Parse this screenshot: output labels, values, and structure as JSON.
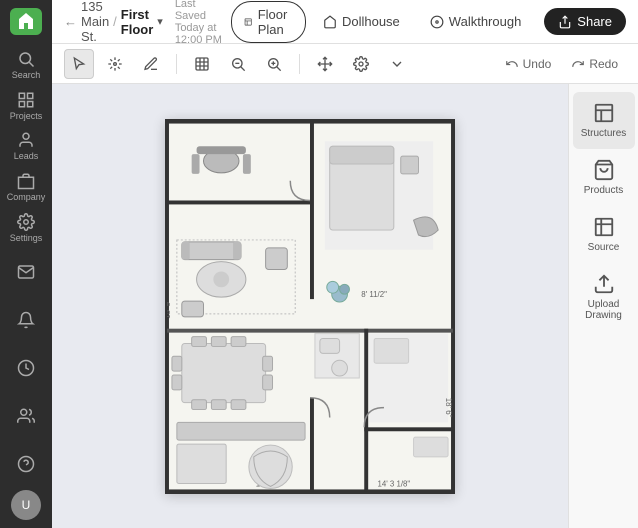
{
  "sidebar": {
    "logo_letter": "h",
    "items": [
      {
        "id": "search",
        "label": "Search",
        "icon": "search"
      },
      {
        "id": "projects",
        "label": "Projects",
        "icon": "grid"
      },
      {
        "id": "leads",
        "label": "Leads",
        "icon": "person"
      },
      {
        "id": "company",
        "label": "Company",
        "icon": "building"
      },
      {
        "id": "settings",
        "label": "Settings",
        "icon": "gear"
      }
    ],
    "bottom_items": [
      {
        "id": "mail",
        "icon": "mail"
      },
      {
        "id": "bell",
        "icon": "bell"
      },
      {
        "id": "clock",
        "icon": "clock"
      },
      {
        "id": "person2",
        "icon": "person2"
      },
      {
        "id": "help",
        "icon": "help"
      }
    ]
  },
  "topbar": {
    "back_label": "135 Main St.",
    "breadcrumb_separator": "/",
    "current_page": "First Floor",
    "saved_text": "Last Saved Today at 12:00 PM",
    "tabs": [
      {
        "id": "floor-plan",
        "label": "Floor Plan",
        "active": true
      },
      {
        "id": "dollhouse",
        "label": "Dollhouse",
        "active": false
      },
      {
        "id": "walkthrough",
        "label": "Walkthrough",
        "active": false
      }
    ],
    "share_label": "Share"
  },
  "toolbar": {
    "tools": [
      {
        "id": "select",
        "label": "Select"
      },
      {
        "id": "annotate",
        "label": "Annotate"
      },
      {
        "id": "draw",
        "label": "Draw"
      },
      {
        "id": "detect",
        "label": "Detect"
      },
      {
        "id": "zoom-out",
        "label": "Zoom Out"
      },
      {
        "id": "zoom-in",
        "label": "Zoom In"
      },
      {
        "id": "pan",
        "label": "Pan"
      },
      {
        "id": "settings2",
        "label": "Settings"
      }
    ],
    "undo_label": "Undo",
    "redo_label": "Redo"
  },
  "right_panel": {
    "items": [
      {
        "id": "structures",
        "label": "Structures",
        "active": true
      },
      {
        "id": "products",
        "label": "Products",
        "active": false
      },
      {
        "id": "source",
        "label": "Source",
        "active": false
      },
      {
        "id": "upload",
        "label": "Upload Drawing",
        "active": false
      }
    ]
  }
}
